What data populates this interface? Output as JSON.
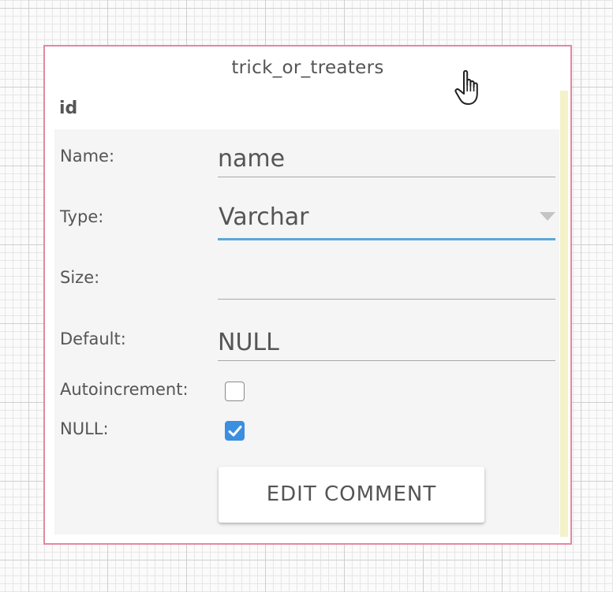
{
  "table": {
    "title": "trick_or_treaters",
    "field_name": "id"
  },
  "editor": {
    "name_label": "Name:",
    "name_value": "name",
    "type_label": "Type:",
    "type_value": "Varchar",
    "size_label": "Size:",
    "size_value": "",
    "default_label": "Default:",
    "default_value": "NULL",
    "autoincrement_label": "Autoincrement:",
    "autoincrement_checked": false,
    "null_label": "NULL:",
    "null_checked": true,
    "edit_comment_label": "EDIT COMMENT"
  },
  "colors": {
    "table_border": "#e4889f",
    "select_underline": "#59a9d8",
    "checkbox_checked": "#3b8ee0",
    "scroll_track": "#f3f2c8"
  },
  "icons": {
    "cursor": "hand-pointer-icon",
    "dropdown": "caret-down-icon",
    "check": "check-icon"
  }
}
